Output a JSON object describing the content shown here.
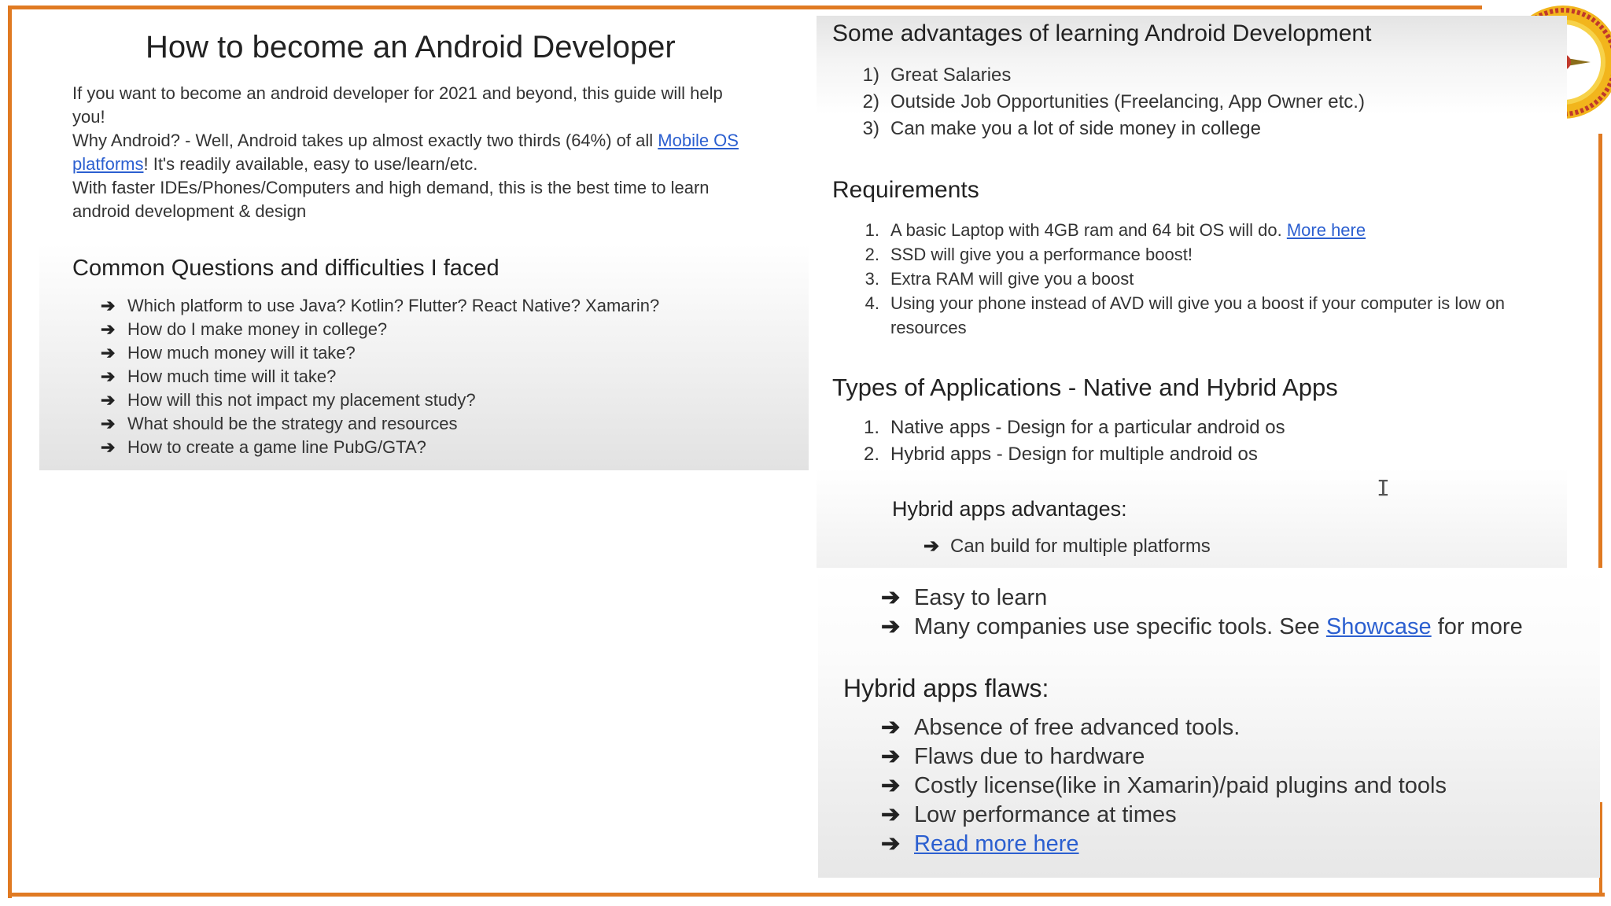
{
  "left": {
    "title": "How to become an Android Developer",
    "intro_line1": "If you want to become an android developer for 2021 and beyond, this guide will help",
    "intro_line2": "you!",
    "why_prefix": "Why Android? - Well, Android takes up almost exactly two thirds (64%) of all ",
    "why_link_part1": "Mobile OS",
    "why_link_part2": "platforms",
    "why_suffix": "! It's readily available, easy to use/learn/etc.",
    "faster_line1": "With faster IDEs/Phones/Computers and high demand, this is the best time to learn",
    "faster_line2": "android development & design",
    "questions_heading": "Common Questions and difficulties I faced",
    "questions": [
      "Which platform to use Java? Kotlin? Flutter? React Native? Xamarin?",
      "How do I make money in college?",
      "How much money will it take?",
      "How much time will it take?",
      "How will this not impact my placement study?",
      "What should be the strategy and resources",
      "How to create a game line PubG/GTA?"
    ]
  },
  "right": {
    "advantages_heading": "Some advantages of learning Android Development",
    "advantages": [
      {
        "num": "1)",
        "text": "Great Salaries"
      },
      {
        "num": "2)",
        "text": "Outside Job Opportunities (Freelancing, App Owner etc.)"
      },
      {
        "num": "3)",
        "text": "Can make you a lot of side money in college"
      }
    ],
    "requirements_heading": "Requirements",
    "requirements": [
      {
        "num": "1.",
        "text": "A basic Laptop with 4GB ram and 64 bit OS will do. ",
        "link": "More here"
      },
      {
        "num": "2.",
        "text": "SSD will give you a performance boost!"
      },
      {
        "num": "3.",
        "text": "Extra RAM will give you a boost"
      },
      {
        "num": "4.",
        "text": "Using your phone instead of AVD will give you a boost if your computer is low on"
      }
    ],
    "requirements_4_cont": "resources",
    "types_heading": "Types of Applications - Native and Hybrid Apps",
    "types": [
      {
        "num": "1.",
        "text": "Native apps - Design for a particular android os"
      },
      {
        "num": "2.",
        "text": "Hybrid apps - Design for multiple android os"
      }
    ],
    "hybrid_adv_heading": "Hybrid apps advantages:",
    "hybrid_adv": [
      "Can build for multiple platforms",
      "Easy to learn"
    ],
    "companies_prefix": "Many companies use specific tools. See ",
    "companies_link": "Showcase",
    "companies_suffix": " for more",
    "flaws_heading": "Hybrid apps flaws:",
    "flaws": [
      "Absence of free advanced tools.",
      "Flaws due to hardware",
      "Costly license(like in Xamarin)/paid plugins and tools",
      "Low performance at times"
    ],
    "read_more": "Read more here"
  },
  "glyphs": {
    "arrow": "➔",
    "text_cursor": "I"
  },
  "colors": {
    "frame": "#e07a22",
    "link": "#2b5fd0"
  },
  "icons": {
    "logo": "circular-seal-logo-icon"
  }
}
